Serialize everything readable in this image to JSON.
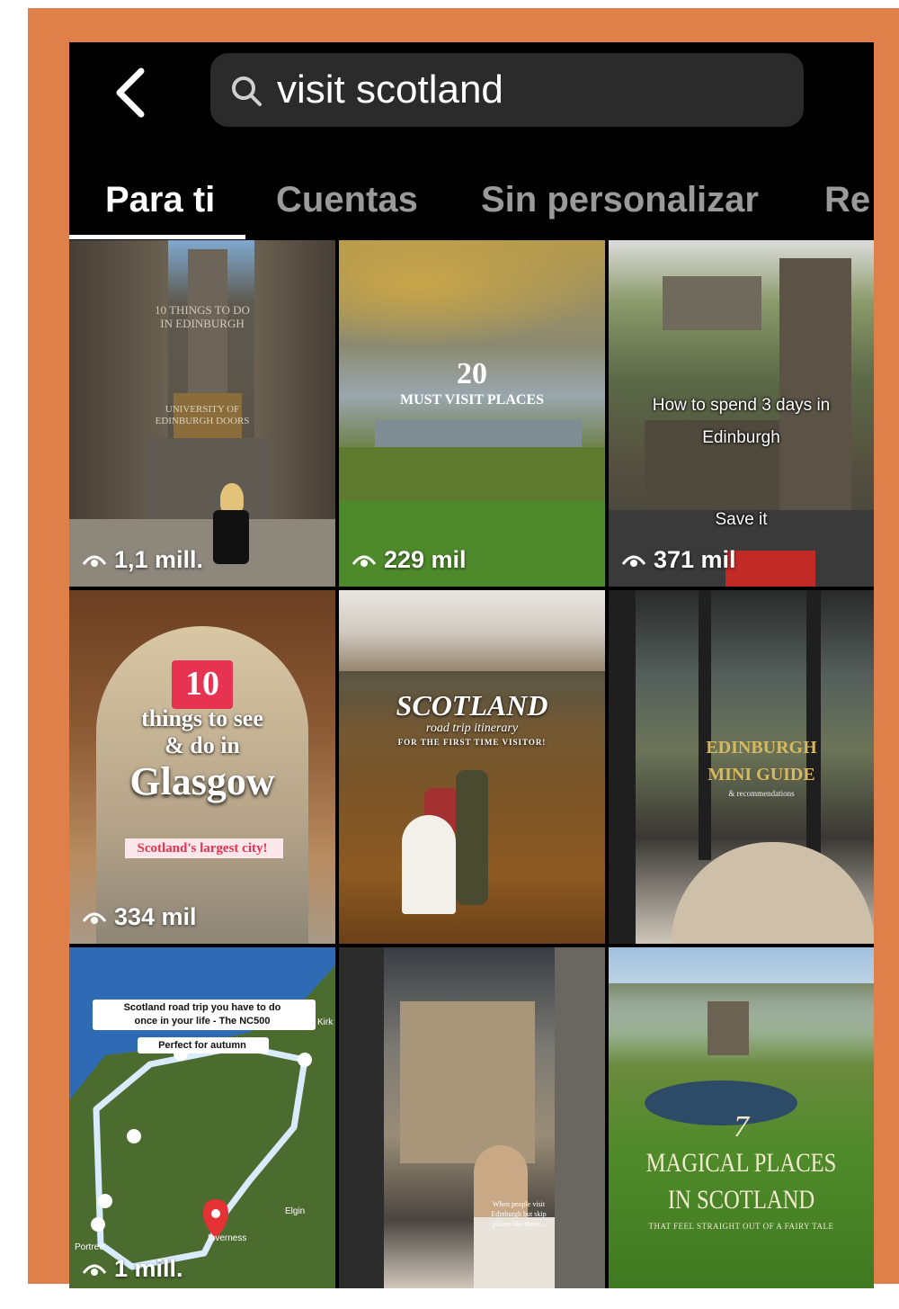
{
  "search": {
    "query": "visit scotland"
  },
  "tabs": [
    {
      "label": "Para ti"
    },
    {
      "label": "Cuentas"
    },
    {
      "label": "Sin personalizar"
    },
    {
      "label": "Re"
    }
  ],
  "grid": {
    "tiles": [
      {
        "views": "1,1 mill.",
        "overlay": [
          "10 THINGS TO DO",
          "IN EDINBURGH",
          "UNIVERSITY OF",
          "EDINBURGH DOORS"
        ]
      },
      {
        "views": "229 mil",
        "overlay": [
          "20",
          "MUST VISIT PLACES"
        ]
      },
      {
        "views": "371 mil",
        "overlay": [
          "How to spend 3 days in",
          "Edinburgh",
          "Save it"
        ]
      },
      {
        "views": "334 mil",
        "overlay": [
          "10",
          "things to see",
          "& do in",
          "Glasgow",
          "Scotland's largest city!"
        ]
      },
      {
        "views": "",
        "overlay": [
          "SCOTLAND",
          "road trip itinerary",
          "FOR THE FIRST TIME VISITOR!"
        ]
      },
      {
        "views": "",
        "overlay": [
          "EDINBURGH",
          "MINI GUIDE",
          "& recommendations"
        ]
      },
      {
        "views": "1 mill.",
        "overlay": [
          "Scotland road trip you have to do",
          "once in your life - The NC500",
          "Perfect for autumn",
          "Inverness",
          "Elgin",
          "Portree",
          "Kirk"
        ]
      },
      {
        "views": "",
        "overlay": [
          "When people visit",
          "Edinburgh but skip",
          "places like these..."
        ]
      },
      {
        "views": "",
        "overlay": [
          "7",
          "MAGICAL PLACES",
          "IN SCOTLAND",
          "THAT FEEL STRAIGHT OUT OF A FAIRY TALE"
        ]
      }
    ]
  }
}
